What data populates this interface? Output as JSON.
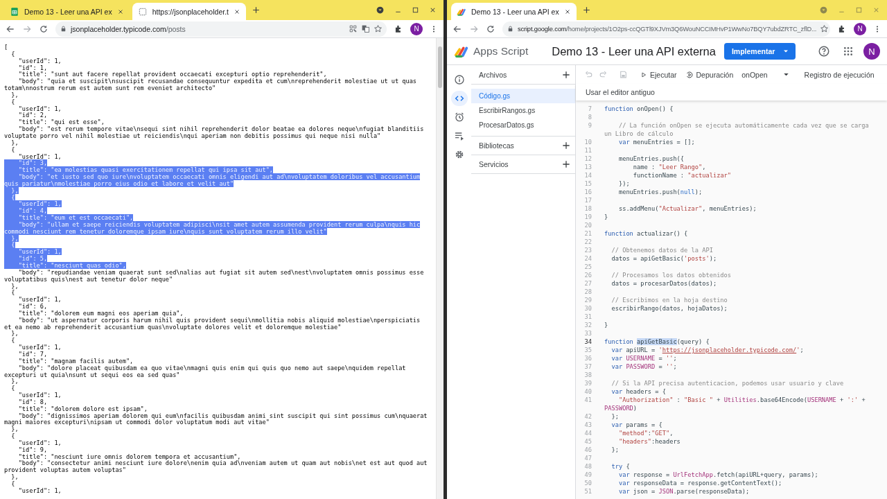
{
  "left_window": {
    "tabs": [
      {
        "title": "Demo 13 - Leer una API ex",
        "kind": "sheets",
        "selected": false
      },
      {
        "title": "https://jsonplaceholder.t",
        "kind": "page",
        "selected": true
      }
    ],
    "address": {
      "host": "jsonplaceholder.typicode.com",
      "path": "/posts"
    },
    "avatar": "N",
    "lines": [
      {
        "text": "[",
        "selected": false
      },
      {
        "text": "  {",
        "selected": false
      },
      {
        "text": "    \"userId\": 1,",
        "selected": false
      },
      {
        "text": "    \"id\": 1,",
        "selected": false
      },
      {
        "text": "    \"title\": \"sunt aut facere repellat provident occaecati excepturi optio reprehenderit\",",
        "selected": false
      },
      {
        "text": "    \"body\": \"quia et suscipit\\nsuscipit recusandae consequuntur expedita et cum\\nreprehenderit molestiae ut ut quas",
        "selected": false
      },
      {
        "text": "totam\\nnostrum rerum est autem sunt rem eveniet architecto\"",
        "selected": false
      },
      {
        "text": "  },",
        "selected": false
      },
      {
        "text": "  {",
        "selected": false
      },
      {
        "text": "    \"userId\": 1,",
        "selected": false
      },
      {
        "text": "    \"id\": 2,",
        "selected": false
      },
      {
        "text": "    \"title\": \"qui est esse\",",
        "selected": false
      },
      {
        "text": "    \"body\": \"est rerum tempore vitae\\nsequi sint nihil reprehenderit dolor beatae ea dolores neque\\nfugiat blanditiis",
        "selected": false
      },
      {
        "text": "voluptate porro vel nihil molestiae ut reiciendis\\nqui aperiam non debitis possimus qui neque nisi nulla\"",
        "selected": false
      },
      {
        "text": "  },",
        "selected": false
      },
      {
        "text": "  {",
        "selected": false
      },
      {
        "text": "    \"userId\": 1,",
        "selected": false
      },
      {
        "text": "    \"id\": 3,",
        "selected": true
      },
      {
        "text": "    \"title\": \"ea molestias quasi exercitationem repellat qui ipsa sit aut\",",
        "selected": true
      },
      {
        "text": "    \"body\": \"et iusto sed quo iure\\nvoluptatem occaecati omnis eligendi aut ad\\nvoluptatem doloribus vel accusantium",
        "selected": true
      },
      {
        "text": "quis pariatur\\nmolestiae porro eius odio et labore et velit aut\"",
        "selected": true
      },
      {
        "text": "  },",
        "selected": true
      },
      {
        "text": "  {",
        "selected": true
      },
      {
        "text": "    \"userId\": 1,",
        "selected": true
      },
      {
        "text": "    \"id\": 4,",
        "selected": true
      },
      {
        "text": "    \"title\": \"eum et est occaecati\",",
        "selected": true
      },
      {
        "text": "    \"body\": \"ullam et saepe reiciendis voluptatem adipisci\\nsit amet autem assumenda provident rerum culpa\\nquis hic",
        "selected": true
      },
      {
        "text": "commodi nesciunt rem tenetur doloremque ipsam iure\\nquis sunt voluptatem rerum illo velit\"",
        "selected": true
      },
      {
        "text": "  },",
        "selected": true
      },
      {
        "text": "  {",
        "selected": true
      },
      {
        "text": "    \"userId\": 1,",
        "selected": true
      },
      {
        "text": "    \"id\": 5,",
        "selected": true
      },
      {
        "text": "    \"title\": \"nesciunt quas odio\",",
        "selected": true
      },
      {
        "text": "    \"body\": \"repudiandae veniam quaerat sunt sed\\nalias aut fugiat sit autem sed\\nest\\nvoluptatem omnis possimus esse",
        "selected": false
      },
      {
        "text": "voluptatibus quis\\nest aut tenetur dolor neque\"",
        "selected": false
      },
      {
        "text": "  },",
        "selected": false
      },
      {
        "text": "  {",
        "selected": false
      },
      {
        "text": "    \"userId\": 1,",
        "selected": false
      },
      {
        "text": "    \"id\": 6,",
        "selected": false
      },
      {
        "text": "    \"title\": \"dolorem eum magni eos aperiam quia\",",
        "selected": false
      },
      {
        "text": "    \"body\": \"ut aspernatur corporis harum nihil quis provident sequi\\nmollitia nobis aliquid molestiae\\nperspiciatis",
        "selected": false
      },
      {
        "text": "et ea nemo ab reprehenderit accusantium quas\\nvoluptate dolores velit et doloremque molestiae\"",
        "selected": false
      },
      {
        "text": "  },",
        "selected": false
      },
      {
        "text": "  {",
        "selected": false
      },
      {
        "text": "    \"userId\": 1,",
        "selected": false
      },
      {
        "text": "    \"id\": 7,",
        "selected": false
      },
      {
        "text": "    \"title\": \"magnam facilis autem\",",
        "selected": false
      },
      {
        "text": "    \"body\": \"dolore placeat quibusdam ea quo vitae\\nmagni quis enim qui quis quo nemo aut saepe\\nquidem repellat",
        "selected": false
      },
      {
        "text": "excepturi ut quia\\nsunt ut sequi eos ea sed quas\"",
        "selected": false
      },
      {
        "text": "  },",
        "selected": false
      },
      {
        "text": "  {",
        "selected": false
      },
      {
        "text": "    \"userId\": 1,",
        "selected": false
      },
      {
        "text": "    \"id\": 8,",
        "selected": false
      },
      {
        "text": "    \"title\": \"dolorem dolore est ipsam\",",
        "selected": false
      },
      {
        "text": "    \"body\": \"dignissimos aperiam dolorem qui eum\\nfacilis quibusdam animi sint suscipit qui sint possimus cum\\nquaerat",
        "selected": false
      },
      {
        "text": "magni maiores excepturi\\nipsam ut commodi dolor voluptatum modi aut vitae\"",
        "selected": false
      },
      {
        "text": "  },",
        "selected": false
      },
      {
        "text": "  {",
        "selected": false
      },
      {
        "text": "    \"userId\": 1,",
        "selected": false
      },
      {
        "text": "    \"id\": 9,",
        "selected": false
      },
      {
        "text": "    \"title\": \"nesciunt iure omnis dolorem tempora et accusantium\",",
        "selected": false
      },
      {
        "text": "    \"body\": \"consectetur animi nesciunt iure dolore\\nenim quia ad\\nveniam autem ut quam aut nobis\\net est aut quod aut",
        "selected": false
      },
      {
        "text": "provident voluptas autem voluptas\"",
        "selected": false
      },
      {
        "text": "  },",
        "selected": false
      },
      {
        "text": "  {",
        "selected": false
      },
      {
        "text": "    \"userId\": 1,",
        "selected": false
      }
    ]
  },
  "right_window": {
    "tabs": [
      {
        "title": "Demo 13 - Leer una API ex",
        "kind": "apps-script",
        "selected": true
      }
    ],
    "address": {
      "host": "script.google.com",
      "path": "/home/projects/1O2ps-ccQGTl9XJVm3Q6WouNCCIMHvP1WwNo7BQY7ubdZRTC_zflD..."
    },
    "avatar": "N",
    "app": {
      "product": "Apps Script",
      "project_title": "Demo 13 - Leer una API externa",
      "deploy_button": "Implementar",
      "avatar": "N",
      "rail": [
        {
          "kind": "info",
          "selected": false
        },
        {
          "kind": "code",
          "selected": true
        },
        {
          "kind": "clock",
          "selected": false
        },
        {
          "kind": "runs",
          "selected": false
        },
        {
          "kind": "settings",
          "selected": false
        }
      ],
      "files_header": "Archivos",
      "files": [
        {
          "name": "Código.gs",
          "selected": true
        },
        {
          "name": "EscribirRangos.gs",
          "selected": false
        },
        {
          "name": "ProcesarDatos.gs",
          "selected": false
        }
      ],
      "sections": [
        "Bibliotecas",
        "Servicios"
      ],
      "toolbar": {
        "run": "Ejecutar",
        "debug": "Depuración",
        "function": "onOpen",
        "log": "Registro de ejecución",
        "legacy": "Usar el editor antiguo"
      },
      "code": [
        {
          "number": "7",
          "current": false,
          "tokens": [
            {
              "kind": "kw",
              "text": "function"
            },
            {
              "kind": "p",
              "text": " onOpen() {"
            }
          ]
        },
        {
          "number": "8",
          "current": false
        },
        {
          "number": "9",
          "current": false,
          "tokens": [
            {
              "kind": "com",
              "text": "    // La función onOpen se ejecuta automáticamente cada vez que se carga"
            }
          ]
        },
        {
          "tokens": [
            {
              "kind": "com",
              "text": "un Libro de cálculo"
            }
          ]
        },
        {
          "number": "10",
          "current": false,
          "tokens": [
            {
              "kind": "kw",
              "text": "    var"
            },
            {
              "kind": "p",
              "text": " menuEntries = [];"
            }
          ]
        },
        {
          "number": "11",
          "current": false
        },
        {
          "number": "12",
          "current": false,
          "tokens": [
            {
              "kind": "p",
              "text": "    menuEntries.push({"
            }
          ]
        },
        {
          "number": "13",
          "current": false,
          "tokens": [
            {
              "kind": "p",
              "text": "        name : "
            },
            {
              "kind": "str",
              "text": "\"Leer Rango\""
            },
            {
              "kind": "p",
              "text": ","
            }
          ]
        },
        {
          "number": "14",
          "current": false,
          "tokens": [
            {
              "kind": "p",
              "text": "        functionName : "
            },
            {
              "kind": "str",
              "text": "\"actualizar\""
            }
          ]
        },
        {
          "number": "15",
          "current": false,
          "tokens": [
            {
              "kind": "p",
              "text": "    });"
            }
          ]
        },
        {
          "number": "16",
          "current": false,
          "tokens": [
            {
              "kind": "p",
              "text": "    menuEntries.push("
            },
            {
              "kind": "lit",
              "text": "null"
            },
            {
              "kind": "p",
              "text": ");"
            }
          ]
        },
        {
          "number": "17",
          "current": false
        },
        {
          "number": "18",
          "current": false,
          "tokens": [
            {
              "kind": "p",
              "text": "    ss.addMenu("
            },
            {
              "kind": "str",
              "text": "\"Actualizar\""
            },
            {
              "kind": "p",
              "text": ", menuEntries);"
            }
          ]
        },
        {
          "number": "19",
          "current": false,
          "tokens": [
            {
              "kind": "p",
              "text": "}"
            }
          ]
        },
        {
          "number": "20",
          "current": false
        },
        {
          "number": "21",
          "current": false,
          "tokens": [
            {
              "kind": "kw",
              "text": "function"
            },
            {
              "kind": "p",
              "text": " actualizar() {"
            }
          ]
        },
        {
          "number": "22",
          "current": false
        },
        {
          "number": "23",
          "current": false,
          "tokens": [
            {
              "kind": "com",
              "text": "  // Obtenemos datos de la API"
            }
          ]
        },
        {
          "number": "24",
          "current": false,
          "tokens": [
            {
              "kind": "p",
              "text": "  datos = apiGetBasic("
            },
            {
              "kind": "str",
              "text": "'posts'"
            },
            {
              "kind": "p",
              "text": ");"
            }
          ]
        },
        {
          "number": "25",
          "current": false
        },
        {
          "number": "26",
          "current": false,
          "tokens": [
            {
              "kind": "com",
              "text": "  // Procesamos los datos obtenidos"
            }
          ]
        },
        {
          "number": "27",
          "current": false,
          "tokens": [
            {
              "kind": "p",
              "text": "  datos = procesarDatos(datos);"
            }
          ]
        },
        {
          "number": "28",
          "current": false
        },
        {
          "number": "29",
          "current": false,
          "tokens": [
            {
              "kind": "com",
              "text": "  // Escribimos en la hoja destino"
            }
          ]
        },
        {
          "number": "30",
          "current": false,
          "tokens": [
            {
              "kind": "p",
              "text": "  escribirRango(datos, hojaDatos);"
            }
          ]
        },
        {
          "number": "31",
          "current": false
        },
        {
          "number": "32",
          "current": false,
          "tokens": [
            {
              "kind": "p",
              "text": "}"
            }
          ]
        },
        {
          "number": "33",
          "current": false
        },
        {
          "number": "34",
          "current": true,
          "tokens": [
            {
              "kind": "kw",
              "text": "function "
            },
            {
              "kind": "sel",
              "text": "apiGetBasic"
            },
            {
              "kind": "p",
              "text": "(query) {"
            }
          ]
        },
        {
          "number": "35",
          "current": false,
          "tokens": [
            {
              "kind": "kw",
              "text": "  var"
            },
            {
              "kind": "p",
              "text": " apiURL = "
            },
            {
              "kind": "str",
              "text": "'"
            },
            {
              "kind": "link",
              "text": "https://jsonplaceholder.typicode.com/"
            },
            {
              "kind": "str",
              "text": "'"
            },
            {
              "kind": "p",
              "text": ";"
            }
          ]
        },
        {
          "number": "36",
          "current": false,
          "tokens": [
            {
              "kind": "kw",
              "text": "  var"
            },
            {
              "kind": "con",
              "text": " USERNAME"
            },
            {
              "kind": "p",
              "text": " = "
            },
            {
              "kind": "str",
              "text": "''"
            },
            {
              "kind": "p",
              "text": ";"
            }
          ]
        },
        {
          "number": "37",
          "current": false,
          "tokens": [
            {
              "kind": "kw",
              "text": "  var"
            },
            {
              "kind": "con",
              "text": " PASSWORD"
            },
            {
              "kind": "p",
              "text": " = "
            },
            {
              "kind": "str",
              "text": "''"
            },
            {
              "kind": "p",
              "text": ";"
            }
          ]
        },
        {
          "number": "38",
          "current": false
        },
        {
          "number": "39",
          "current": false,
          "tokens": [
            {
              "kind": "com",
              "text": "  // Si la API precisa autenticacion, podemos usar usuario y clave"
            }
          ]
        },
        {
          "number": "40",
          "current": false,
          "tokens": [
            {
              "kind": "kw",
              "text": "  var"
            },
            {
              "kind": "p",
              "text": " headers = {"
            }
          ]
        },
        {
          "number": "41",
          "current": false,
          "tokens": [
            {
              "kind": "str",
              "text": "    \"Authorization\""
            },
            {
              "kind": "p",
              "text": " : "
            },
            {
              "kind": "str",
              "text": "\"Basic \""
            },
            {
              "kind": "p",
              "text": " + "
            },
            {
              "kind": "con",
              "text": "Utilities"
            },
            {
              "kind": "p",
              "text": ".base64Encode("
            },
            {
              "kind": "con",
              "text": "USERNAME"
            },
            {
              "kind": "p",
              "text": " + "
            },
            {
              "kind": "str",
              "text": "':'"
            },
            {
              "kind": "p",
              "text": " +"
            }
          ]
        },
        {
          "tokens": [
            {
              "kind": "con",
              "text": "PASSWORD"
            },
            {
              "kind": "p",
              "text": ")"
            }
          ]
        },
        {
          "number": "42",
          "current": false,
          "tokens": [
            {
              "kind": "p",
              "text": "  };"
            }
          ]
        },
        {
          "number": "43",
          "current": false,
          "tokens": [
            {
              "kind": "kw",
              "text": "  var"
            },
            {
              "kind": "p",
              "text": " params = {"
            }
          ]
        },
        {
          "number": "44",
          "current": false,
          "tokens": [
            {
              "kind": "str",
              "text": "    \"method\""
            },
            {
              "kind": "p",
              "text": ":"
            },
            {
              "kind": "str",
              "text": "\"GET\""
            },
            {
              "kind": "p",
              "text": ","
            }
          ]
        },
        {
          "number": "45",
          "current": false,
          "tokens": [
            {
              "kind": "str",
              "text": "    \"headers\""
            },
            {
              "kind": "p",
              "text": ":headers"
            }
          ]
        },
        {
          "number": "46",
          "current": false,
          "tokens": [
            {
              "kind": "p",
              "text": "  };"
            }
          ]
        },
        {
          "number": "47",
          "current": false
        },
        {
          "number": "48",
          "current": false,
          "tokens": [
            {
              "kind": "kw",
              "text": "  try"
            },
            {
              "kind": "p",
              "text": " {"
            }
          ]
        },
        {
          "number": "49",
          "current": false,
          "tokens": [
            {
              "kind": "kw",
              "text": "    var"
            },
            {
              "kind": "p",
              "text": " response = "
            },
            {
              "kind": "con",
              "text": "UrlFetchApp"
            },
            {
              "kind": "p",
              "text": ".fetch(apiURL+query, params);"
            }
          ]
        },
        {
          "number": "50",
          "current": false,
          "tokens": [
            {
              "kind": "kw",
              "text": "    var"
            },
            {
              "kind": "p",
              "text": " responseData = response.getContentText();"
            }
          ]
        },
        {
          "number": "51",
          "current": false,
          "tokens": [
            {
              "kind": "kw",
              "text": "    var"
            },
            {
              "kind": "p",
              "text": " json = "
            },
            {
              "kind": "con",
              "text": "JSON"
            },
            {
              "kind": "p",
              "text": ".parse(responseData);"
            }
          ]
        }
      ]
    }
  }
}
